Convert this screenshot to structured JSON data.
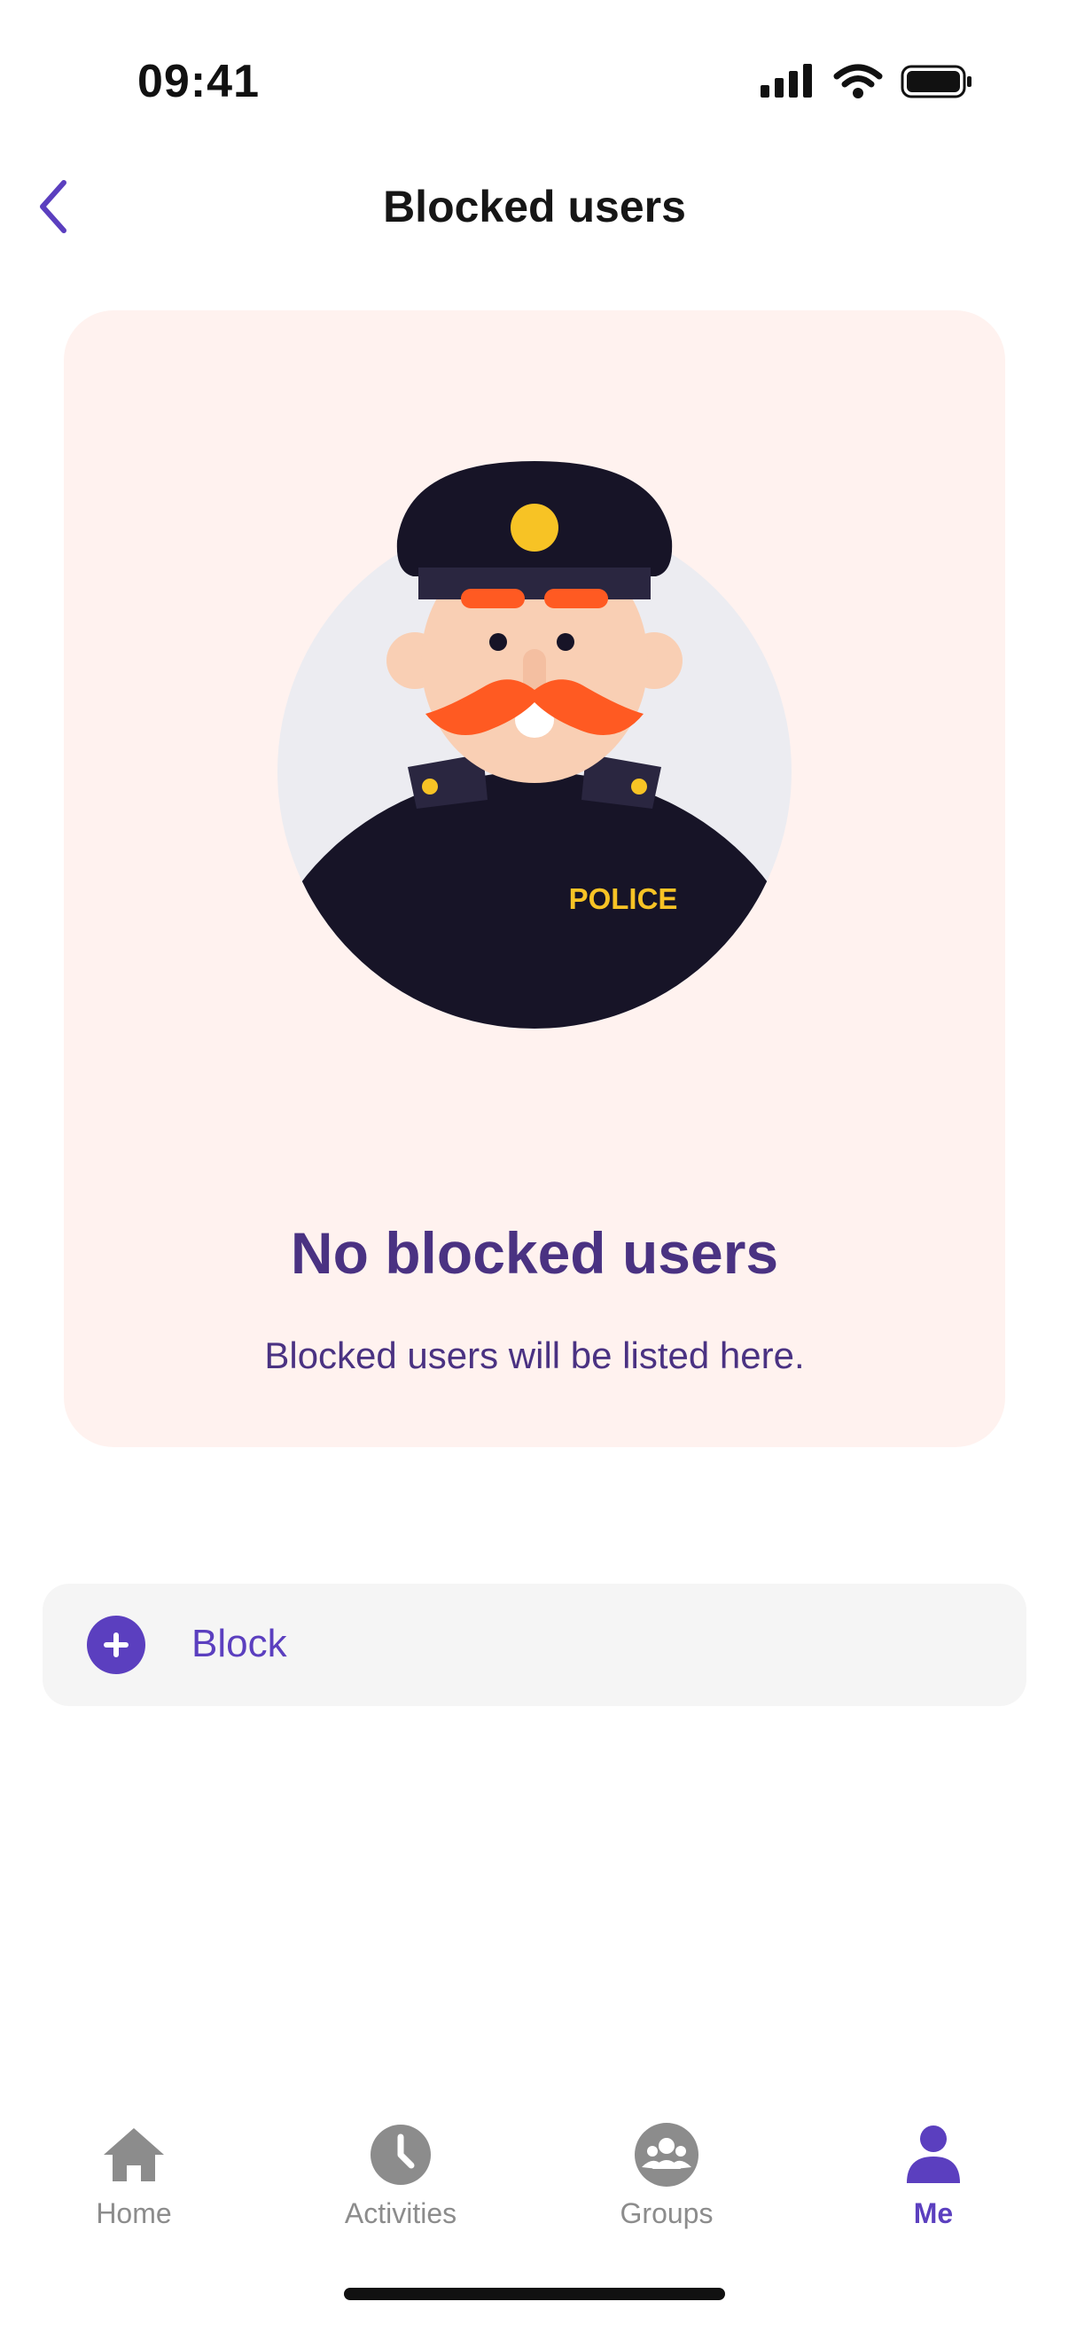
{
  "status_bar": {
    "time": "09:41",
    "icons": [
      "cellular-signal-icon",
      "wifi-icon",
      "battery-icon"
    ]
  },
  "header": {
    "title": "Blocked users",
    "back_icon": "chevron-left-icon"
  },
  "empty_state": {
    "illustration": "police-officer-illustration",
    "badge_text": "POLICE",
    "title": "No blocked users",
    "subtitle": "Blocked users will be listed here."
  },
  "block_action": {
    "label": "Block",
    "icon": "plus-circle-icon"
  },
  "tab_bar": {
    "items": [
      {
        "label": "Home",
        "icon": "home-icon",
        "active": false
      },
      {
        "label": "Activities",
        "icon": "clock-icon",
        "active": false
      },
      {
        "label": "Groups",
        "icon": "groups-icon",
        "active": false
      },
      {
        "label": "Me",
        "icon": "person-icon",
        "active": true
      }
    ]
  },
  "colors": {
    "accent": "#5b3fbf",
    "title_text": "#4a3282",
    "card_background": "#fff2ef",
    "row_background": "#f5f5f5",
    "inactive_tab": "#8c8c8c"
  }
}
